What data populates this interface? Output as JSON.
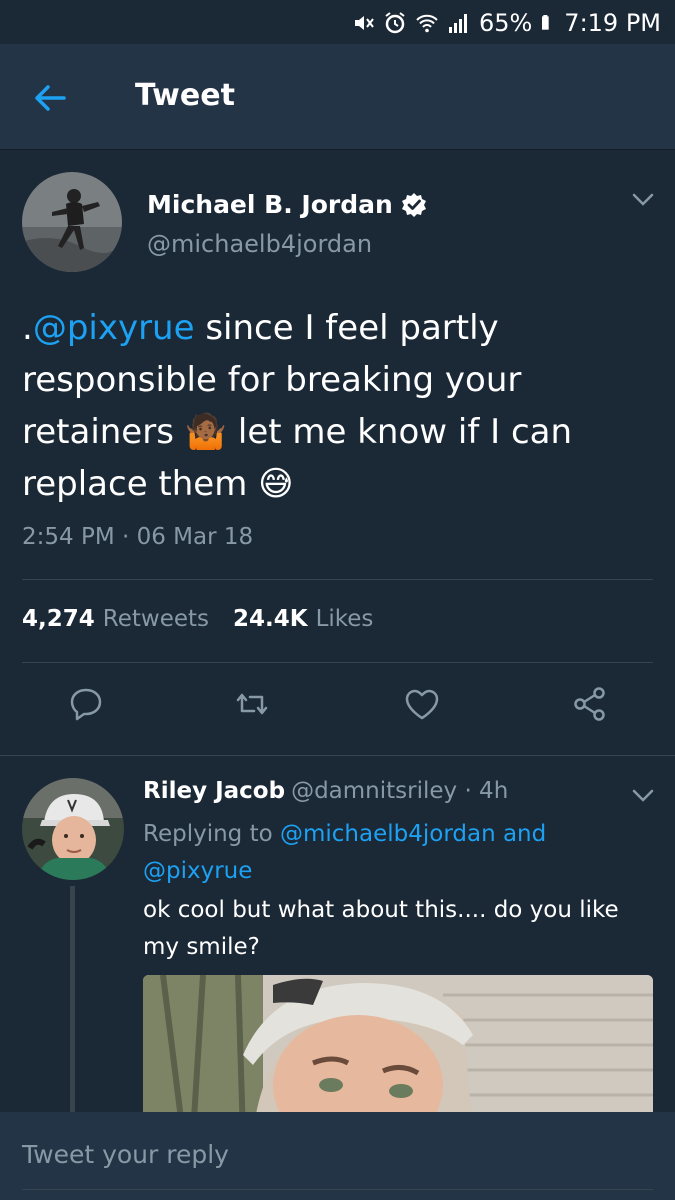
{
  "status_bar": {
    "battery": "65%",
    "time": "7:19 PM"
  },
  "app_bar": {
    "title": "Tweet",
    "back_icon": "arrow-left-icon"
  },
  "tweet": {
    "author_name": "Michael B. Jordan",
    "author_handle": "@michaelb4jordan",
    "text_prefix": ".",
    "mention": "@pixyrue",
    "text_line1_rest": " since I feel partly",
    "text_line2": "responsible for breaking your",
    "text_line3_a": "retainers ",
    "emoji_shrug": "🤷🏾",
    "text_line3_b": " let me know if I can",
    "text_line4": "replace them ",
    "emoji_sweat": "😅",
    "timestamp": "2:54 PM · 06 Mar 18",
    "retweets_count": "4,274",
    "retweets_label": "Retweets",
    "likes_count": "24.4K",
    "likes_label": "Likes",
    "accent_color": "#1da1f2"
  },
  "reply": {
    "author_name": "Riley Jacob",
    "meta": "@damnitsriley · 4h",
    "replying_prefix": "Replying to ",
    "replying_handle1": "@michaelb4jordan",
    "replying_and": " and",
    "replying_handle2": "@pixyrue",
    "text": "ok cool but what about this.... do you like my smile?"
  },
  "composer": {
    "placeholder": "Tweet your reply"
  }
}
